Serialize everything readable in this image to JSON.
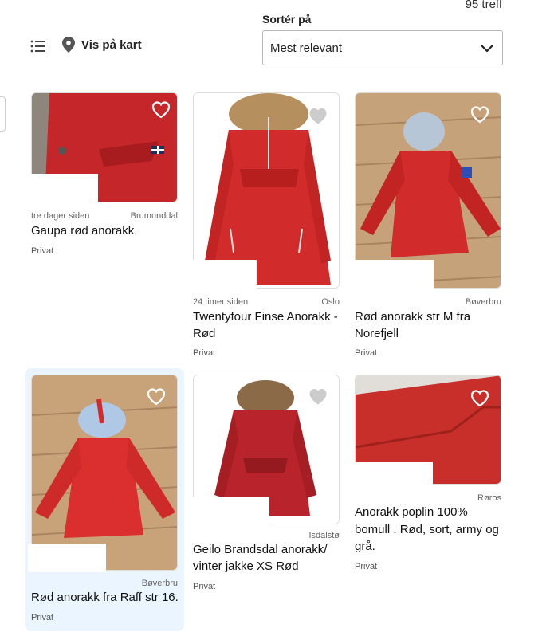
{
  "header": {
    "hits": "95 treff",
    "sort_label": "Sortér på",
    "sort_value": "Mest relevant",
    "map_link": "Vis på kart"
  },
  "icons": {
    "list": "list-view-icon",
    "map": "map-pin-icon",
    "chevron": "chevron-down-icon",
    "favorite": "heart-icon"
  },
  "colors": {
    "accent_red": "#cf2a2a",
    "active_card_bg": "#eaf5ff"
  },
  "listings": [
    {
      "time": "tre dager siden",
      "location": "Brumunddal",
      "title": "Gaupa rød anorakk.",
      "seller": "Privat"
    },
    {
      "time": "24 timer siden",
      "location": "Oslo",
      "title_line1": "Twentyfour Finse Anorakk -",
      "title_line2": "Rød",
      "seller": "Privat"
    },
    {
      "time": "",
      "location": "Bøverbru",
      "title_line1": "Rød anorakk str M fra",
      "title_line2": "Norefjell",
      "seller": "Privat"
    },
    {
      "time": "",
      "location": "Bøverbru",
      "title": "Rød anorakk fra Raff str 16.",
      "seller": "Privat"
    },
    {
      "time": "",
      "location": "Isdalstø",
      "title_line1": "Geilo Brandsdal anorakk/",
      "title_line2": "vinter jakke XS Rød",
      "seller": "Privat"
    },
    {
      "time": "",
      "location": "Røros",
      "title_line1": "Anorakk poplin 100%",
      "title_line2": "bomull . Rød, sort, army og",
      "title_line3": "grå.",
      "seller": "Privat"
    }
  ]
}
